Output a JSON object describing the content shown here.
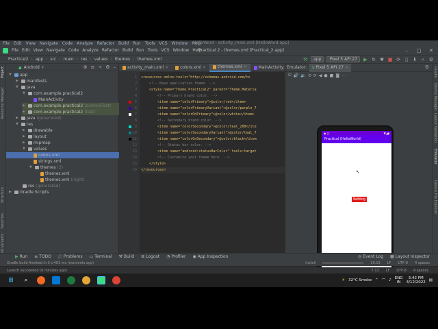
{
  "outer_window": {
    "menu": [
      "File",
      "Edit",
      "View",
      "Navigate",
      "Code",
      "Analyze",
      "Refactor",
      "Build",
      "Run",
      "Tools",
      "VCS",
      "Window",
      "Help"
    ],
    "title": "HelloWord - activity_main.xml [HelloWord.app]"
  },
  "window": {
    "menu": [
      "File",
      "Edit",
      "View",
      "Navigate",
      "Code",
      "Analyze",
      "Refactor",
      "Build",
      "Run",
      "Tools",
      "VCS",
      "Window",
      "Help"
    ],
    "title": "Practical 2 - themes.xml [Practical_2.app]"
  },
  "navbar": {
    "crumbs": [
      "Practical2",
      "app",
      "src",
      "main",
      "res",
      "values",
      "themes",
      "themes.xml"
    ],
    "run_config": "app",
    "device": "Pixel 5 API 27"
  },
  "left_strip": [
    "Project",
    "Resource Manager",
    "Structure",
    "Favorites",
    "Build Variants"
  ],
  "right_strip": [
    "Gradle",
    "Device Manager",
    "Layout Validation",
    "Emulator",
    "Device File Explorer"
  ],
  "project": {
    "view": "Android",
    "tree": [
      {
        "label": "app",
        "depth": 0
      },
      {
        "label": "manifests",
        "depth": 1
      },
      {
        "label": "java",
        "depth": 1
      },
      {
        "label": "com.example.practical2",
        "depth": 2
      },
      {
        "label": "MainActivity",
        "depth": 3
      },
      {
        "label": "com.example.practical2",
        "suffix": "(androidTest)",
        "depth": 2
      },
      {
        "label": "com.example.practical2",
        "suffix": "(test)",
        "depth": 2
      },
      {
        "label": "java",
        "suffix": "(generated)",
        "depth": 1
      },
      {
        "label": "res",
        "depth": 1
      },
      {
        "label": "drawable",
        "depth": 2
      },
      {
        "label": "layout",
        "depth": 2
      },
      {
        "label": "mipmap",
        "depth": 2
      },
      {
        "label": "values",
        "depth": 2
      },
      {
        "label": "colors.xml",
        "depth": 3
      },
      {
        "label": "strings.xml",
        "depth": 3
      },
      {
        "label": "themes",
        "suffix": "(2)",
        "depth": 3
      },
      {
        "label": "themes.xml",
        "depth": 4
      },
      {
        "label": "themes.xml",
        "suffix": "(night)",
        "depth": 4
      },
      {
        "label": "res",
        "suffix": "(generated)",
        "depth": 1
      },
      {
        "label": "Gradle Scripts",
        "depth": 0
      }
    ]
  },
  "tabs": [
    {
      "label": "activity_main.xml"
    },
    {
      "label": "colors.xml"
    },
    {
      "label": "themes.xml"
    },
    {
      "label": "MainActivity.kt"
    }
  ],
  "editor": {
    "line_numbers": [
      "1",
      "2",
      "3",
      "4",
      "5",
      "6",
      "7",
      "8",
      "9",
      "10",
      "11",
      "12",
      "13",
      "14",
      "15",
      "16"
    ],
    "lines": [
      "<resources xmlns:tools=\"http://schemas.android.com/to",
      "    <!-- Base application theme. -->",
      "    <style name=\"Theme.Practical2\" parent=\"Theme.Materia",
      "        <!-- Primary brand color. -->",
      "        <item name=\"colorPrimary\">@color/red</item>",
      "        <item name=\"colorPrimaryVariant\">@color/purple_7",
      "        <item name=\"colorOnPrimary\">@color/white</item>",
      "        <!-- Secondary brand color. -->",
      "        <item name=\"colorSecondary\">@color/teal_200</ite",
      "        <item name=\"colorSecondaryVariant\">@color/teal_7",
      "        <item name=\"colorOnSecondary\">@color/black</item",
      "        <!-- Status bar color. -->",
      "        <item name=\"android:statusBarColor\" tools:target",
      "        <!-- Customize your theme here. -->",
      "    </style>",
      "</resources>"
    ],
    "breadcrumb": "resources"
  },
  "emulator": {
    "label": "Emulator:",
    "device_tab": "Pixel 5 API 27",
    "app_title": "Practical (HelloWorld)",
    "button_label": "Setting"
  },
  "bottom_tools": [
    "Run",
    "TODO",
    "Problems",
    "Terminal",
    "Build",
    "Logcat",
    "Profiler",
    "App Inspection",
    "Event Log",
    "Layout Inspector"
  ],
  "status": {
    "message": "Gradle build finished in 3 s 401 ms (moments ago)",
    "install": "Install",
    "position": "16:13",
    "line_sep": "LF",
    "encoding": "UTF-8",
    "indent": "4 spaces"
  },
  "status2": {
    "message": "Launch succeeded (6 minutes ago)",
    "position": "7:13",
    "line_sep": "LF",
    "encoding": "UTF-8",
    "indent": "4 spaces"
  },
  "taskbar": {
    "weather": "32°C  Smoke",
    "lang_line1": "ENG",
    "lang_line2": "IN",
    "time": "3:42 PM",
    "date": "4/12/2022"
  },
  "colors": {
    "accent": "#4a88c7",
    "android_green": "#3ddc84",
    "app_bar": "#6200ee",
    "button": "#e01919"
  }
}
